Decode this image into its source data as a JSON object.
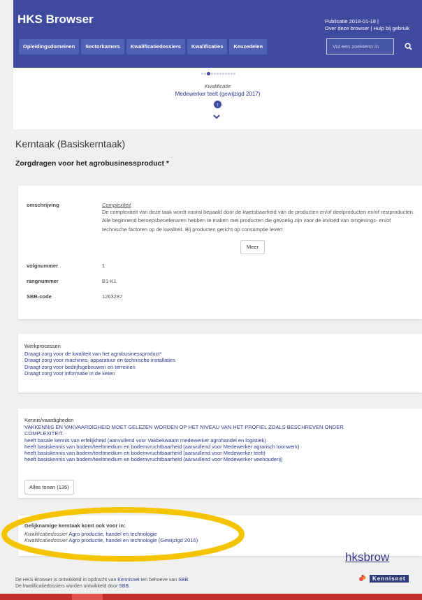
{
  "app": {
    "title": "HKS Browser",
    "publication": "Publicatie 2018-01-18  |",
    "header_links": "Over deze browser  |  Hulp bij gebruik"
  },
  "nav": {
    "items": [
      "Opleidingsdomeinen",
      "Sectorkamers",
      "Kwalificatiedossiers",
      "Kwalificaties",
      "Keuzedelen"
    ]
  },
  "search": {
    "placeholder": "Vul een zoekterm in",
    "icon": "search-icon"
  },
  "pager": {
    "dot_count": 12,
    "active_dot": 2,
    "type_label": "Kwalificatie",
    "name": "Medewerker teelt (gewijzigd 2017)",
    "up_icon": "↑",
    "down_icon": "⌄"
  },
  "page": {
    "title": "Kerntaak (Basiskerntaak)",
    "subtitle": "Zorgdragen voor het agrobusinessproduct *"
  },
  "details": {
    "omschrijving_label": "omschrijving",
    "complexity_label": "Complexiteit",
    "description": "De complexiteit van deze taak wordt vooral bepaald door de kwetsbaarheid van de producten en/of deelproducten en/of restproducten. Alle beginnend beroepsbeoefenaren hebben te maken met producten die gevoelig zijn voor de invloed van omgevings- en/of technische factoren op de kwaliteit. Bij producten gericht op consumptie levert",
    "meer_button": "Meer",
    "volgnummer_label": "volgnummer",
    "volgnummer": "1",
    "rangnummer_label": "rangnummer",
    "rangnummer": "B1-K1",
    "sbb_label": "SBB-code",
    "sbb_code": "1263287"
  },
  "werkprocessen": {
    "title": "Werkprocessen",
    "items": [
      "Draagt zorg voor de kwaliteit van het agrobusinessproduct*",
      "Draagt zorg voor machines, apparatuur en technische installaties",
      "Draagt zorg voor bedrijfsgebouwen en terreinen",
      "Draagt zorg voor informatie in de keten"
    ]
  },
  "kennis": {
    "title": "Kennis/vaardigheden",
    "items": [
      "VAKKENNIS EN VAKVAARDIGHEID MOET GELEZEN WORDEN OP HET NIVEAU VAN HET PROFIEL ZOALS BESCHREVEN ONDER",
      "COMPLEXITEIT.",
      "heeft basale kennis van erfelijkheid (aanvullend voor Vakbekwaam medewerker agrohandel en logistiek)",
      "heeft basiskennis van bodem/teeltmedium en bodemvruchtbaarheid (aanvullend voor Medewerker agrarisch loonwerk)",
      "heeft basiskennis van bodem/teeltmedium en bodemvruchtbaarheid (aanvullend voor Medewerker teelt)",
      "heeft basiskennis van bodem/teeltmedium en bodemvruchtbaarheid (aanvullend voor Medewerker veehouderij)"
    ],
    "show_all": "Alles tonen (135)"
  },
  "gelijknamig": {
    "title": "Gelijknamige kerntaak komt ook voor in:",
    "items": [
      {
        "prefix": "Kwalificatiedossier",
        "text": "Agro productie, handel en technologie"
      },
      {
        "prefix": "Kwalificatiedossier",
        "text": "Agro productie, handel en technologie (Gewijzigd 2016)"
      }
    ]
  },
  "footer": {
    "line1_pre": "De HKS Browser is ontwikkeld in opdracht van",
    "line1_link1": "Kennisnet",
    "line1_mid": "ten behoeve van",
    "line1_link2": "SBB",
    "line2_pre": "De kwalificatiedossiers worden ontwikkeld door",
    "line2_link": "SBB",
    "watermark": "hksbrow",
    "logo_name": "Kennisnet"
  },
  "colors": {
    "header": "#3d4a9e",
    "nav_button": "#5161b5",
    "link": "#2b3a8f",
    "highlight_ellipse": "#f5c400",
    "bottom_bar": "#c4302b"
  }
}
